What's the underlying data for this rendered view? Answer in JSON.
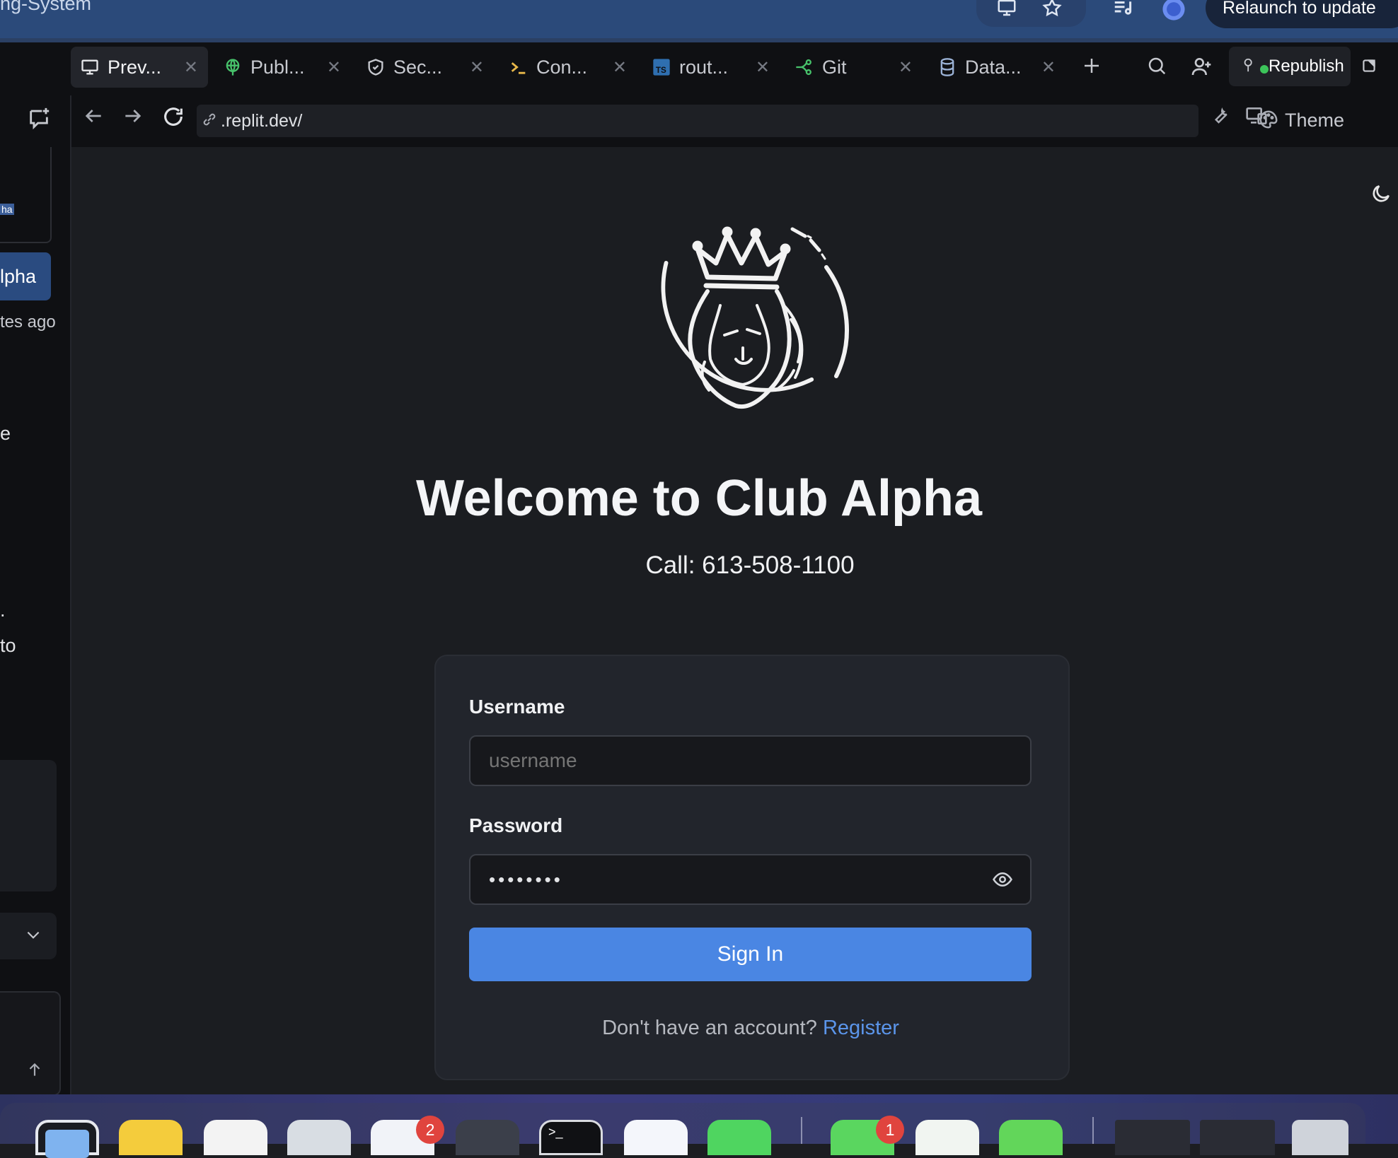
{
  "browser": {
    "window_title": "ng-System",
    "relaunch_label": "Relaunch to update"
  },
  "tabs": [
    {
      "label": "Prev...",
      "icon": "monitor-icon"
    },
    {
      "label": "Publ...",
      "icon": "globe-icon"
    },
    {
      "label": "Sec...",
      "icon": "shield-icon"
    },
    {
      "label": "Con...",
      "icon": "terminal-icon"
    },
    {
      "label": "rout...",
      "icon": "typescript-icon"
    },
    {
      "label": "Git",
      "icon": "git-icon"
    },
    {
      "label": "Data...",
      "icon": "database-icon"
    }
  ],
  "toolbar": {
    "republish_label": "Republish",
    "theme_label": "Theme"
  },
  "address": {
    "url": ".replit.dev/"
  },
  "sidebar": {
    "snippet_top": "ha",
    "alpha_item": "lpha",
    "time_ago": "tes ago",
    "frag_e": "e",
    "frag_dot": ".",
    "frag_to": "to"
  },
  "page": {
    "heading": "Welcome to Club Alpha",
    "call": "Call: 613-508-1100",
    "username_label": "Username",
    "username_placeholder": "username",
    "password_label": "Password",
    "password_value": "••••••••",
    "signin_label": "Sign In",
    "no_account": "Don't have an account?",
    "register_link": "Register"
  },
  "dock": {
    "badge_teams": "2",
    "badge_messages": "1",
    "terminal_prompt": ">_"
  },
  "colors": {
    "accent": "#4a86e3",
    "link": "#5b95ea",
    "background": "#1b1d21"
  }
}
